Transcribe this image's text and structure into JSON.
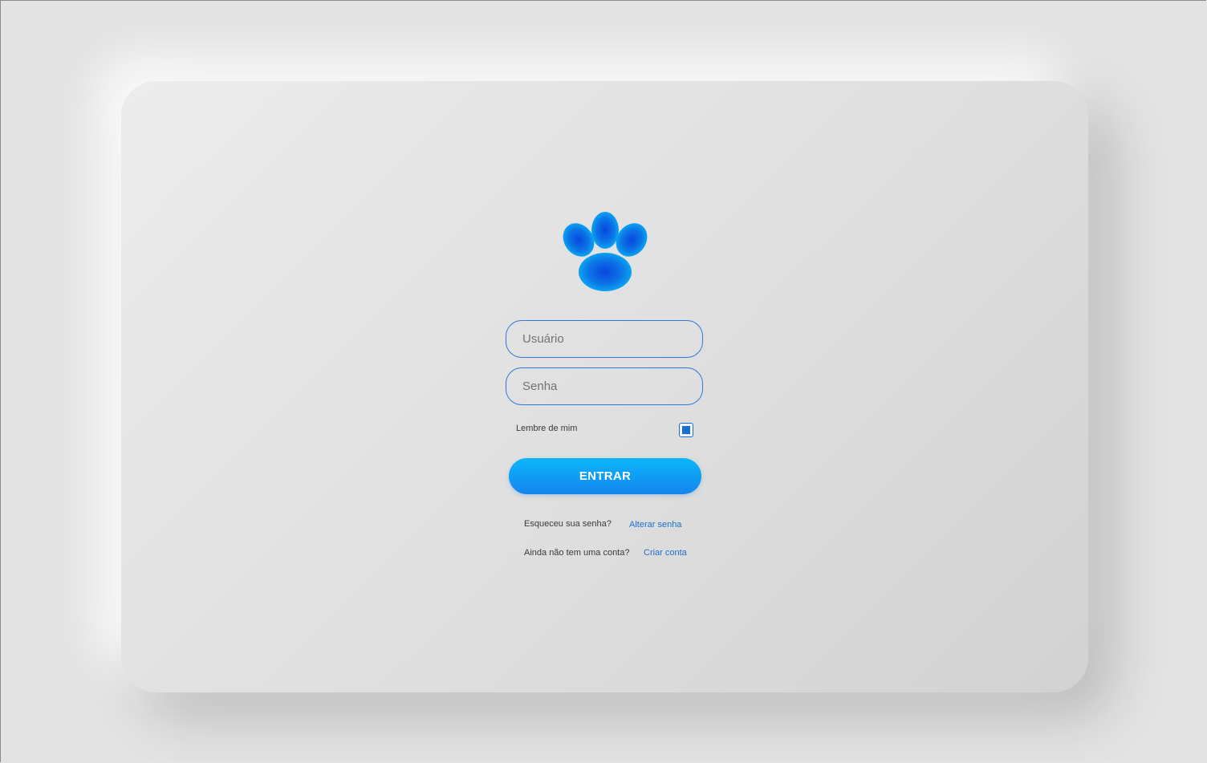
{
  "login": {
    "username_placeholder": "Usuário",
    "password_placeholder": "Senha",
    "remember_label": "Lembre de mim",
    "remember_checked": true,
    "submit_label": "ENTRAR",
    "forgot_text": "Esqueceu sua senha?",
    "forgot_link": "Alterar senha",
    "signup_text": "Ainda não tem uma conta?",
    "signup_link": "Criar conta"
  },
  "logo": {
    "icon": "paw-icon"
  },
  "colors": {
    "accent": "#1b6fd0",
    "button_top": "#0bb6fb",
    "button_bottom": "#1485ee",
    "background": "#e3e3e3"
  }
}
